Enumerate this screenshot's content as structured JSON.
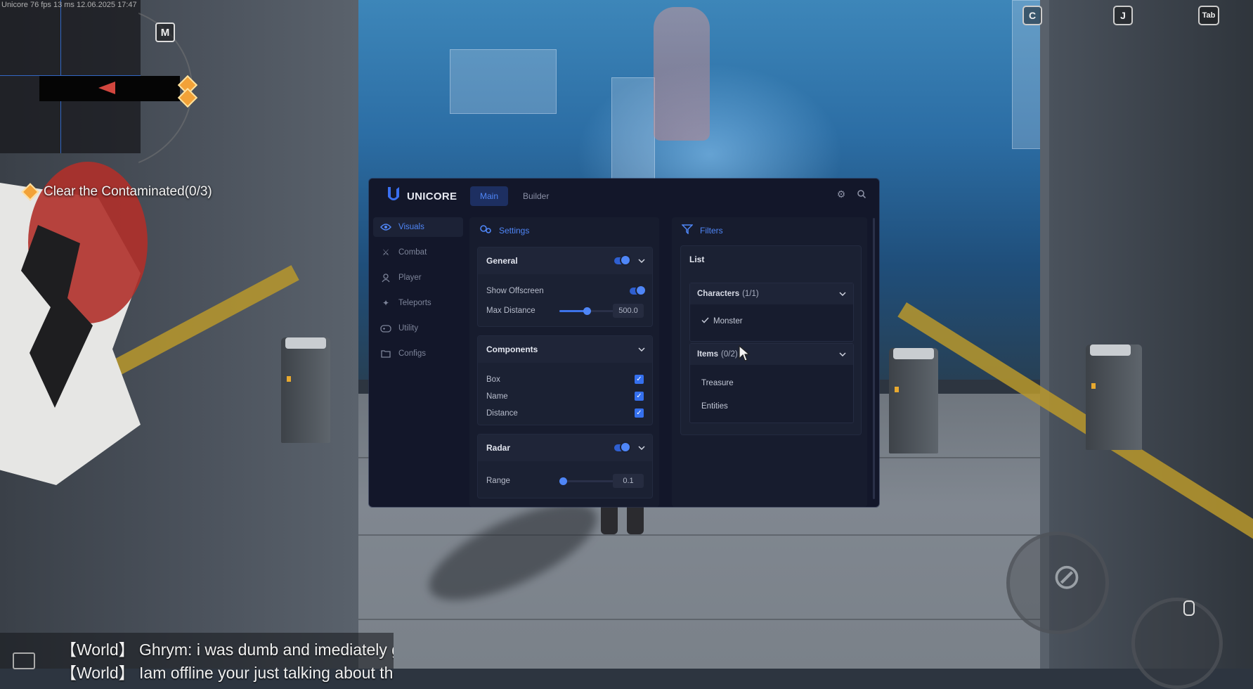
{
  "hud": {
    "stats": "Unicore 76 fps 13 ms 12.06.2025 17:47",
    "map_key": "M",
    "quest": "Clear the Contaminated(0/3)",
    "keys": {
      "c": "C",
      "j": "J",
      "tab": "Tab"
    },
    "chat": [
      "【World】 Ghrym: i was dumb and imediately got ro",
      "【World】 Iam offline your just talking about the ones"
    ]
  },
  "menu": {
    "logo": "UNICORE",
    "tabs": [
      "Main",
      "Builder"
    ],
    "sidebar": [
      {
        "label": "Visuals",
        "icon": "eye-icon",
        "active": true
      },
      {
        "label": "Combat",
        "icon": "sword-icon"
      },
      {
        "label": "Player",
        "icon": "user-icon"
      },
      {
        "label": "Teleports",
        "icon": "teleport-icon"
      },
      {
        "label": "Utility",
        "icon": "gamepad-icon"
      },
      {
        "label": "Configs",
        "icon": "folder-icon"
      }
    ],
    "settings": {
      "title": "Settings",
      "general": {
        "title": "General",
        "enabled": true,
        "show_offscreen_label": "Show Offscreen",
        "show_offscreen": true,
        "max_distance_label": "Max Distance",
        "max_distance": "500.0",
        "max_distance_fraction": 0.5
      },
      "components": {
        "title": "Components",
        "items": [
          {
            "label": "Box",
            "checked": true
          },
          {
            "label": "Name",
            "checked": true
          },
          {
            "label": "Distance",
            "checked": true
          }
        ]
      },
      "radar": {
        "title": "Radar",
        "enabled": true,
        "range_label": "Range",
        "range": "0.1",
        "range_fraction": 0.0
      }
    },
    "filters": {
      "title": "Filters",
      "list_title": "List",
      "characters": {
        "label": "Characters",
        "count": "(1/1)",
        "items": [
          "Monster"
        ]
      },
      "items": {
        "label": "Items",
        "count": "(0/2)",
        "entries": [
          "Treasure",
          "Entities"
        ]
      }
    }
  },
  "colors": {
    "accent": "#4f86f7",
    "panel": "#13172a",
    "quest": "#f2a238"
  }
}
